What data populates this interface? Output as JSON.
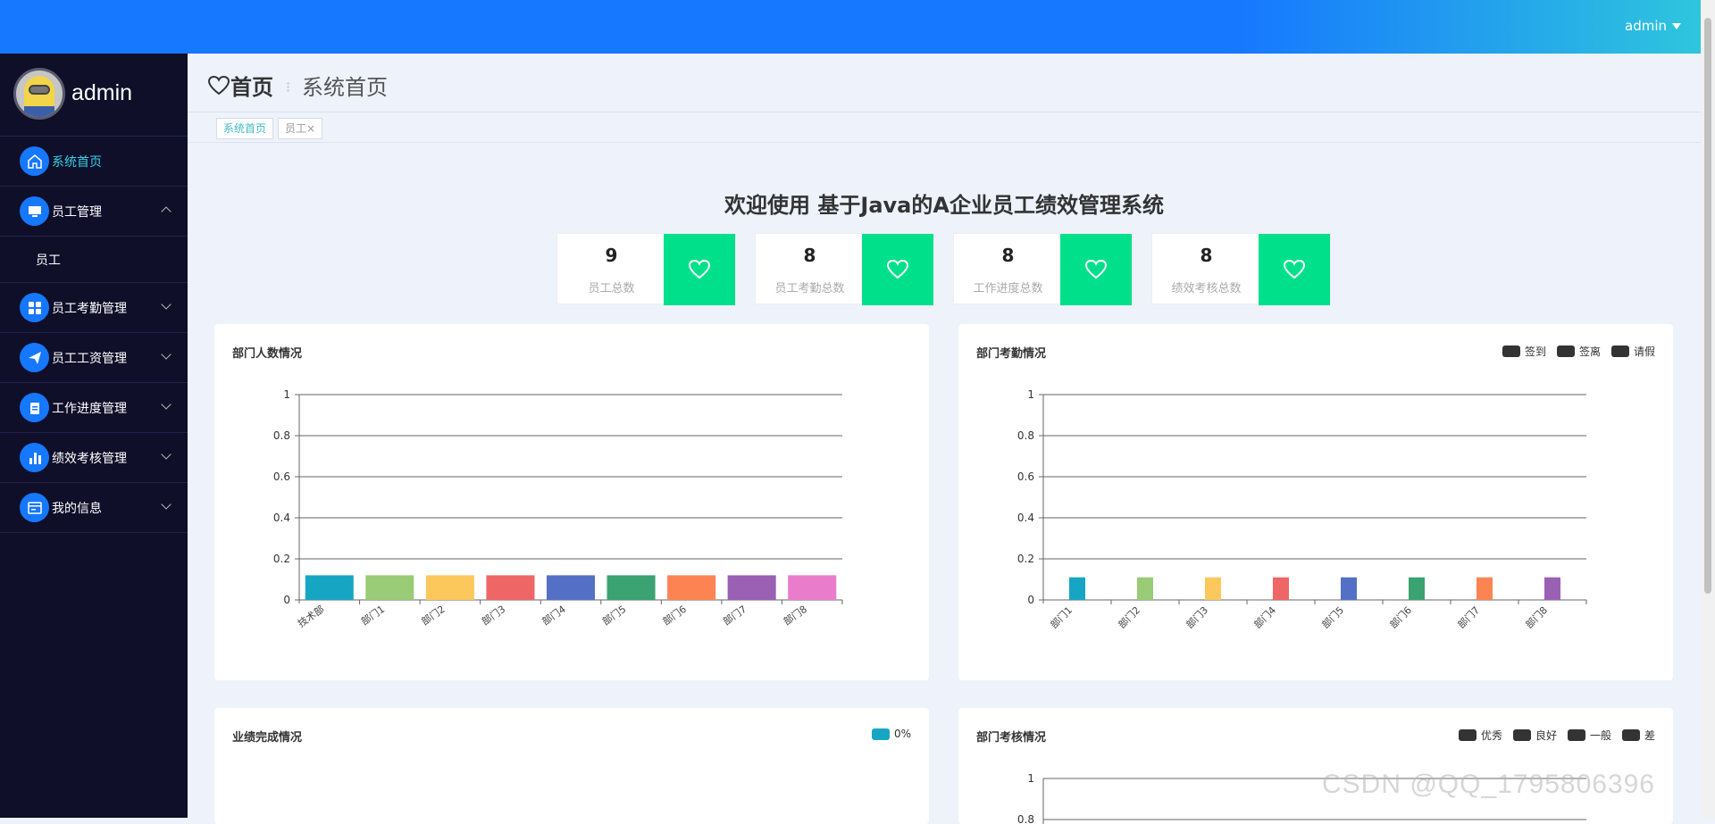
{
  "topbar": {
    "user_label": "admin"
  },
  "sidebar": {
    "user_name": "admin",
    "items": [
      {
        "label": "系统首页",
        "icon": "home-icon"
      },
      {
        "label": "员工管理",
        "icon": "monitor-icon"
      },
      {
        "label": "员工考勤管理",
        "icon": "grid-icon"
      },
      {
        "label": "员工工资管理",
        "icon": "send-icon"
      },
      {
        "label": "工作进度管理",
        "icon": "clipboard-icon"
      },
      {
        "label": "绩效考核管理",
        "icon": "bar-chart-icon"
      },
      {
        "label": "我的信息",
        "icon": "id-card-icon"
      }
    ],
    "sub_item": "员工"
  },
  "breadcrumb": {
    "home": "首页",
    "current": "系统首页"
  },
  "tabs": [
    {
      "label": "系统首页"
    },
    {
      "label": "员工"
    }
  ],
  "welcome": "欢迎使用 基于Java的A企业员工绩效管理系统",
  "stats": [
    {
      "value": "9",
      "label": "员工总数"
    },
    {
      "value": "8",
      "label": "员工考勤总数"
    },
    {
      "value": "8",
      "label": "工作进度总数"
    },
    {
      "value": "8",
      "label": "绩效考核总数"
    }
  ],
  "panels": {
    "dept_people": {
      "title": "部门人数情况"
    },
    "dept_attendance": {
      "title": "部门考勤情况",
      "legend": [
        "签到",
        "签离",
        "请假"
      ]
    },
    "performance": {
      "title": "业绩完成情况",
      "legend": [
        "0%"
      ]
    },
    "dept_review": {
      "title": "部门考核情况",
      "legend": [
        "优秀",
        "良好",
        "一般",
        "差"
      ]
    }
  },
  "chart_data": [
    {
      "type": "bar",
      "title": "部门人数情况",
      "categories": [
        "技术部",
        "部门1",
        "部门2",
        "部门3",
        "部门4",
        "部门5",
        "部门6",
        "部门7",
        "部门8"
      ],
      "values": [
        0.12,
        0.12,
        0.12,
        0.12,
        0.12,
        0.12,
        0.12,
        0.12,
        0.12
      ],
      "colors": [
        "#16a6c3",
        "#9acb76",
        "#fcc85c",
        "#ee6666",
        "#5470c6",
        "#3ba272",
        "#fc8452",
        "#9a60b4",
        "#ea7ccc"
      ],
      "yticks": [
        "0",
        "0.2",
        "0.4",
        "0.6",
        "0.8",
        "1"
      ],
      "ylim": [
        0,
        1
      ]
    },
    {
      "type": "bar",
      "title": "部门考勤情况",
      "categories": [
        "部门1",
        "部门2",
        "部门3",
        "部门4",
        "部门5",
        "部门6",
        "部门7",
        "部门8"
      ],
      "values": [
        0.11,
        0.11,
        0.11,
        0.11,
        0.11,
        0.11,
        0.11,
        0.11
      ],
      "colors": [
        "#16a6c3",
        "#9acb76",
        "#fcc85c",
        "#ee6666",
        "#5470c6",
        "#3ba272",
        "#fc8452",
        "#9a60b4"
      ],
      "yticks": [
        "0",
        "0.2",
        "0.4",
        "0.6",
        "0.8",
        "1"
      ],
      "ylim": [
        0,
        1
      ]
    },
    {
      "type": "pie",
      "title": "业绩完成情况",
      "legend": [
        "0%"
      ]
    },
    {
      "type": "bar",
      "title": "部门考核情况",
      "yticks": [
        "1",
        "0.8"
      ],
      "ylim": [
        0,
        1
      ]
    }
  ],
  "watermark": "CSDN @QQ_1795806396",
  "colors": {
    "primary": "#1677ff",
    "accent": "#00e08a",
    "sidebar": "#0f0f2a"
  }
}
